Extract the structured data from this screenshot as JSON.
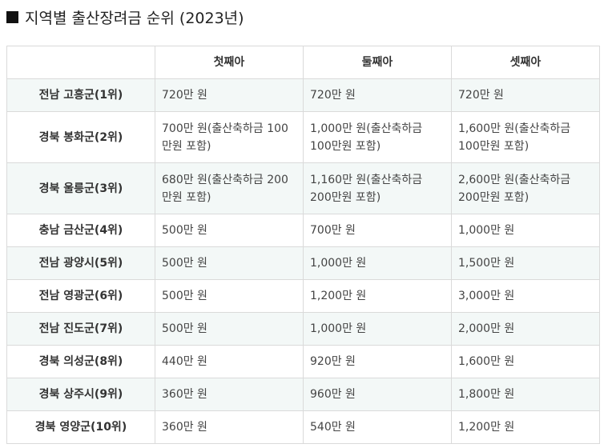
{
  "title": "지역별 출산장려금 순위 (2023년)",
  "table": {
    "headers": [
      "",
      "첫째아",
      "둘째아",
      "셋째아"
    ],
    "rows": [
      {
        "region": "전남 고흥군(1위)",
        "first": "720만 원",
        "second": "720만 원",
        "third": "720만 원"
      },
      {
        "region": "경북 봉화군(2위)",
        "first": "700만 원(출산축하금 100만원 포함)",
        "second": "1,000만 원(출산축하금 100만원 포함)",
        "third": "1,600만 원(출산축하금 100만원 포함)"
      },
      {
        "region": "경북 울릉군(3위)",
        "first": "680만 원(출산축하금 200만원 포함)",
        "second": "1,160만 원(출산축하금 200만원 포함)",
        "third": "2,600만 원(출산축하금 200만원 포함)"
      },
      {
        "region": "충남 금산군(4위)",
        "first": "500만 원",
        "second": "700만 원",
        "third": "1,000만 원"
      },
      {
        "region": "전남 광양시(5위)",
        "first": "500만 원",
        "second": "1,000만 원",
        "third": "1,500만 원"
      },
      {
        "region": "전남 영광군(6위)",
        "first": "500만 원",
        "second": "1,200만 원",
        "third": "3,000만 원"
      },
      {
        "region": "전남 진도군(7위)",
        "first": "500만 원",
        "second": "1,000만 원",
        "third": "2,000만 원"
      },
      {
        "region": "경북 의성군(8위)",
        "first": "440만 원",
        "second": "920만 원",
        "third": "1,600만 원"
      },
      {
        "region": "경북 상주시(9위)",
        "first": "360만 원",
        "second": "960만 원",
        "third": "1,800만 원"
      },
      {
        "region": "경북 영양군(10위)",
        "first": "360만 원",
        "second": "540만 원",
        "third": "1,200만 원"
      }
    ]
  }
}
